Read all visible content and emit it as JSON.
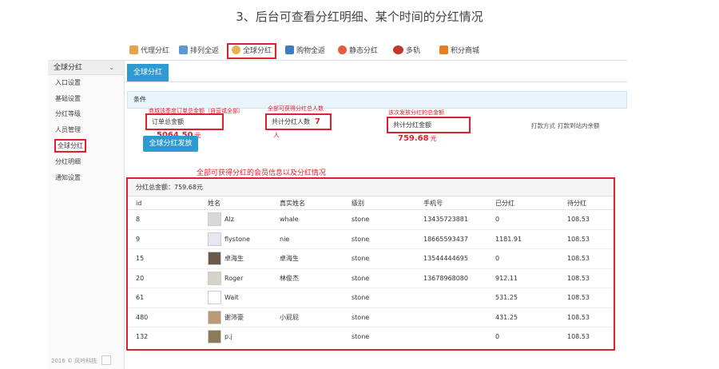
{
  "heading": "3、后台可查看分红明细、某个时间的分红情况",
  "top_tabs": [
    {
      "label": "代理分红",
      "color": "#e8a34a"
    },
    {
      "label": "排列全返",
      "color": "#5a9bd5"
    },
    {
      "label": "全球分红",
      "color": "#e8b24a"
    },
    {
      "label": "购物全返",
      "color": "#3a7ec2"
    },
    {
      "label": "静态分红",
      "color": "#e85a3a"
    },
    {
      "label": "多轨",
      "color": "#c0392b"
    },
    {
      "label": "积分商城",
      "color": "#e67e22"
    }
  ],
  "sidebar": {
    "title": "全球分红",
    "items": [
      "入口设置",
      "基础设置",
      "分红等级",
      "人员管理",
      "全球分红",
      "分红明细",
      "通知设置"
    ],
    "footer": "2016 © 风吟科技"
  },
  "main": {
    "tab": "全球分红",
    "condition": "条件",
    "order_total": {
      "label": "订单总金额",
      "value": "5064.50",
      "unit": "元",
      "note": "商城该季度订单总金额（自营或全部）"
    },
    "member_count": {
      "label": "共计分红人数",
      "value": "7",
      "unit": "人",
      "note": "全部可获得分红总人数"
    },
    "dividend_total": {
      "label": "共计分红金额",
      "value": "759.68",
      "unit": "元",
      "note": "该次发放分红的总金额"
    },
    "pay_method_label": "打款方式",
    "pay_method_value": "打款到站内余额",
    "send_button": "全球分红发放",
    "table_note": "全部可获得分红的会员信息以及分红情况"
  },
  "table": {
    "title": "分红总金额：759.68元",
    "columns": [
      "id",
      "姓名",
      "真实姓名",
      "级别",
      "手机号",
      "已分红",
      "待分红"
    ],
    "rows": [
      {
        "id": "8",
        "name": "Alz",
        "real": "whale",
        "level": "stone",
        "phone": "13435723881",
        "paid": "0",
        "pending": "108.53",
        "avatar": "#d8d8d8"
      },
      {
        "id": "9",
        "name": "flystone",
        "real": "nie",
        "level": "stone",
        "phone": "18665593437",
        "paid": "1181.91",
        "pending": "108.53",
        "avatar": "#e6e6f0"
      },
      {
        "id": "15",
        "name": "卓海生",
        "real": "卓海生",
        "level": "stone",
        "phone": "13544444695",
        "paid": "0",
        "pending": "108.53",
        "avatar": "#6b5a4a"
      },
      {
        "id": "20",
        "name": "Roger",
        "real": "林俊杰",
        "level": "stone",
        "phone": "13678968080",
        "paid": "912.11",
        "pending": "108.53",
        "avatar": "#d9d2c6"
      },
      {
        "id": "61",
        "name": "Wait",
        "real": "",
        "level": "stone",
        "phone": "",
        "paid": "531.25",
        "pending": "108.53",
        "avatar": "#ffffff"
      },
      {
        "id": "480",
        "name": "谢沛豪",
        "real": "小屁屁",
        "level": "stone",
        "phone": "",
        "paid": "431.25",
        "pending": "108.53",
        "avatar": "#b89a78"
      },
      {
        "id": "132",
        "name": "p.j",
        "real": "",
        "level": "stone",
        "phone": "",
        "paid": "0",
        "pending": "108.53",
        "avatar": "#8a7a5a"
      }
    ]
  }
}
